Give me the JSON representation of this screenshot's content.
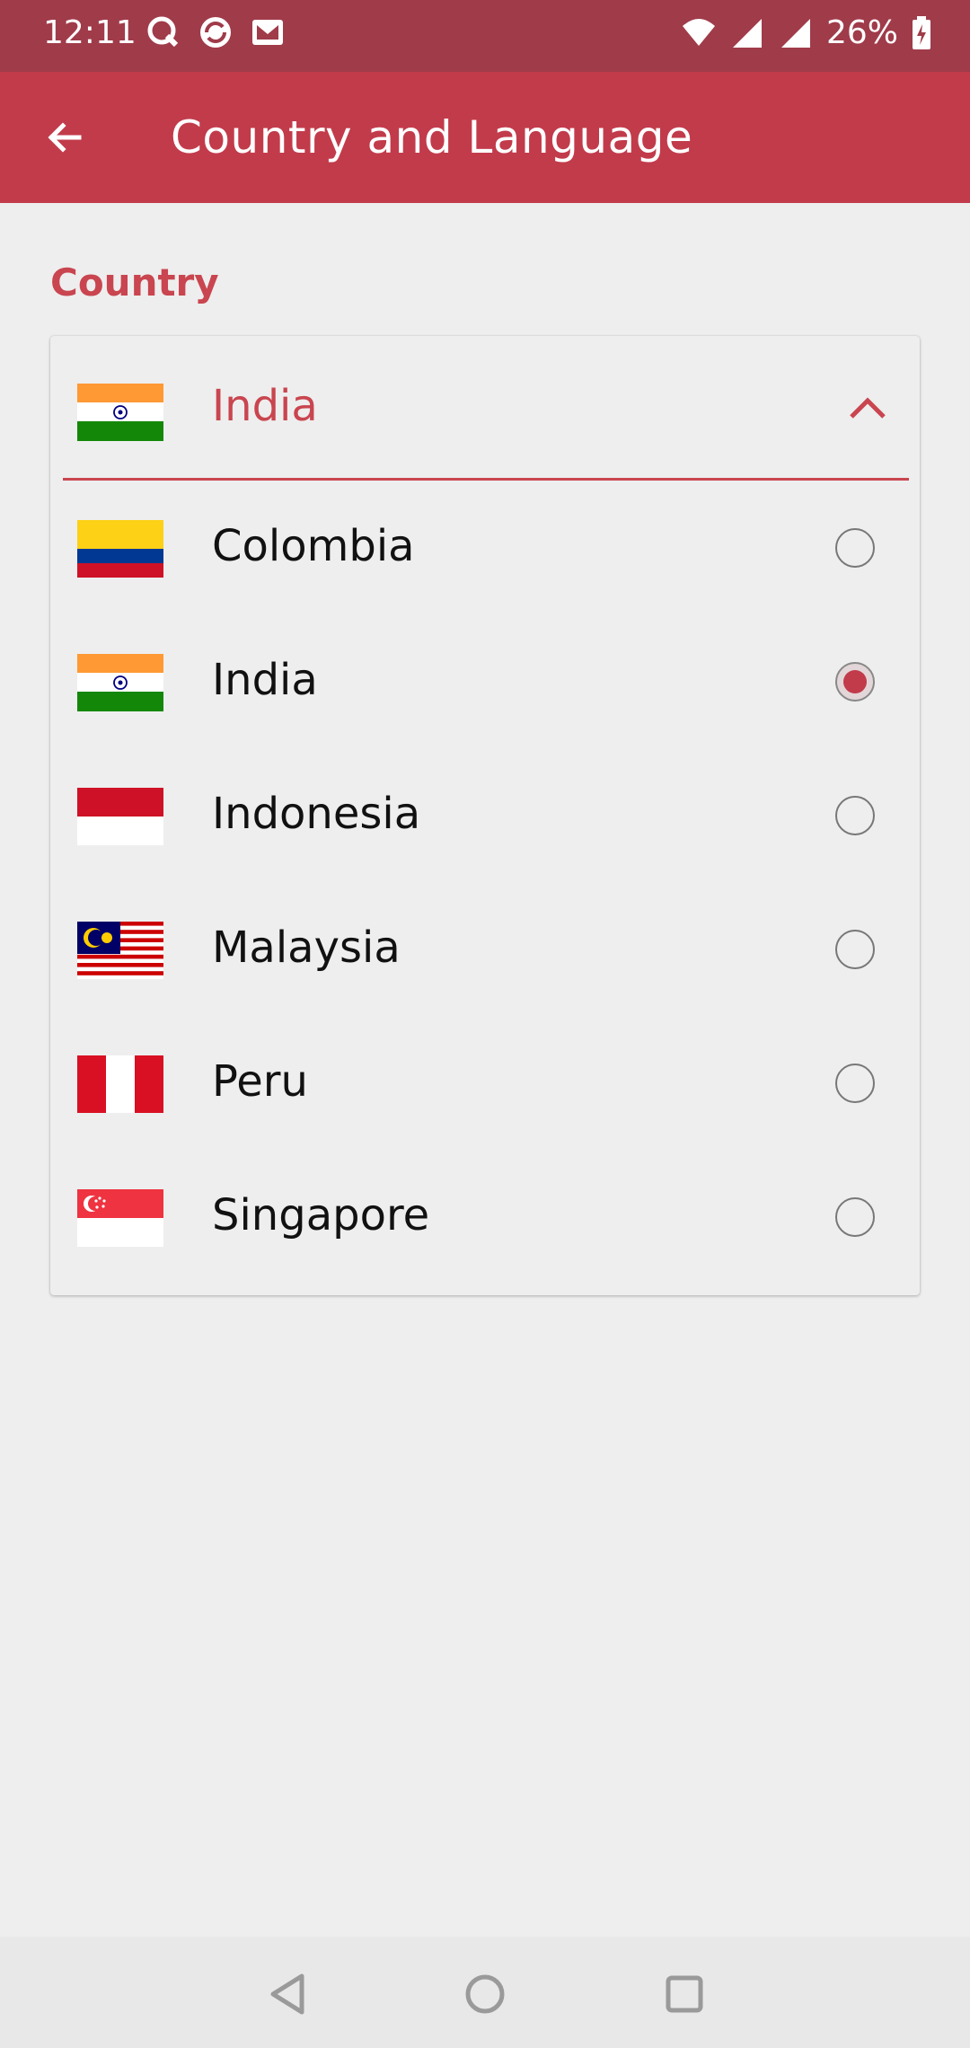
{
  "status_bar": {
    "time": "12:11",
    "battery": "26%",
    "icons": [
      "q-app-icon",
      "sync-app-icon",
      "mail-app-icon",
      "wifi-icon",
      "signal-icon",
      "signal-icon",
      "battery-charging-icon"
    ]
  },
  "app_bar": {
    "title": "Country and Language",
    "back_icon": "arrow-left-icon"
  },
  "section": {
    "label": "Country"
  },
  "selector": {
    "selected": "India",
    "selected_flag": "india",
    "expanded": true,
    "accent_color": "#c23b4b"
  },
  "countries": [
    {
      "name": "Colombia",
      "flag": "colombia",
      "checked": false
    },
    {
      "name": "India",
      "flag": "india",
      "checked": true
    },
    {
      "name": "Indonesia",
      "flag": "indonesia",
      "checked": false
    },
    {
      "name": "Malaysia",
      "flag": "malaysia",
      "checked": false
    },
    {
      "name": "Peru",
      "flag": "peru",
      "checked": false
    },
    {
      "name": "Singapore",
      "flag": "singapore",
      "checked": false
    }
  ],
  "nav_bar": {
    "icons": [
      "back-triangle-icon",
      "home-circle-icon",
      "recents-square-icon"
    ]
  }
}
